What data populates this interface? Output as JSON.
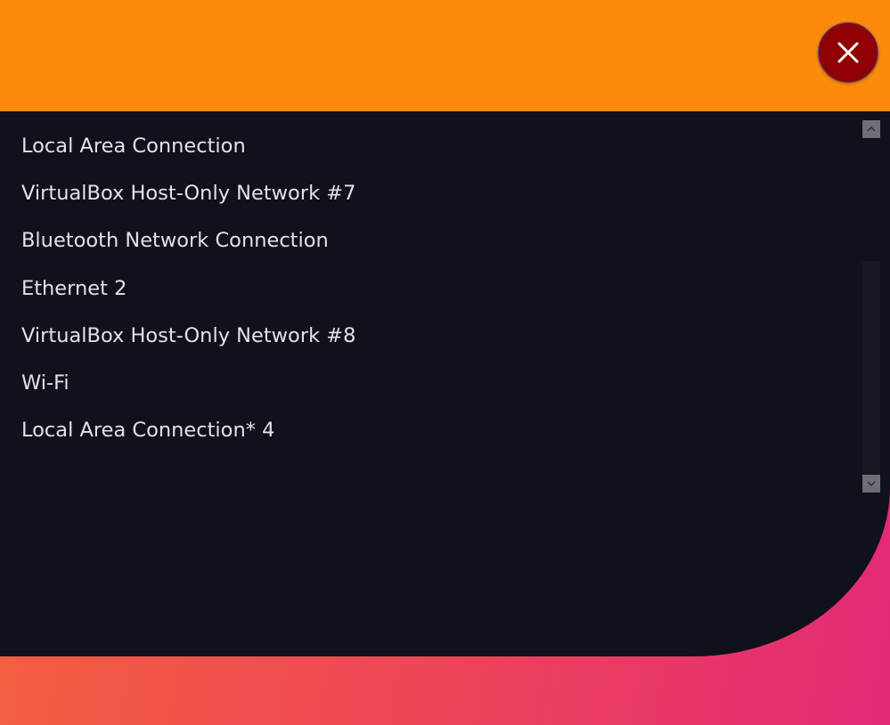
{
  "colors": {
    "header": "#fe8a0c",
    "panel": "#11111b",
    "close_button": "#8f0104",
    "text": "#e3e1e9",
    "gradient_start": "#f5653a",
    "gradient_end": "#e22a76"
  },
  "header": {
    "close_icon": "close-icon"
  },
  "connections": {
    "items": [
      {
        "label": "Local Area Connection"
      },
      {
        "label": "VirtualBox Host-Only Network #7"
      },
      {
        "label": "Bluetooth Network Connection"
      },
      {
        "label": "Ethernet 2"
      },
      {
        "label": "VirtualBox Host-Only Network #8"
      },
      {
        "label": "Wi-Fi"
      },
      {
        "label": "Local Area Connection* 4"
      }
    ]
  },
  "scrollbar": {
    "up_icon": "chevron-up-icon",
    "down_icon": "chevron-down-icon"
  }
}
